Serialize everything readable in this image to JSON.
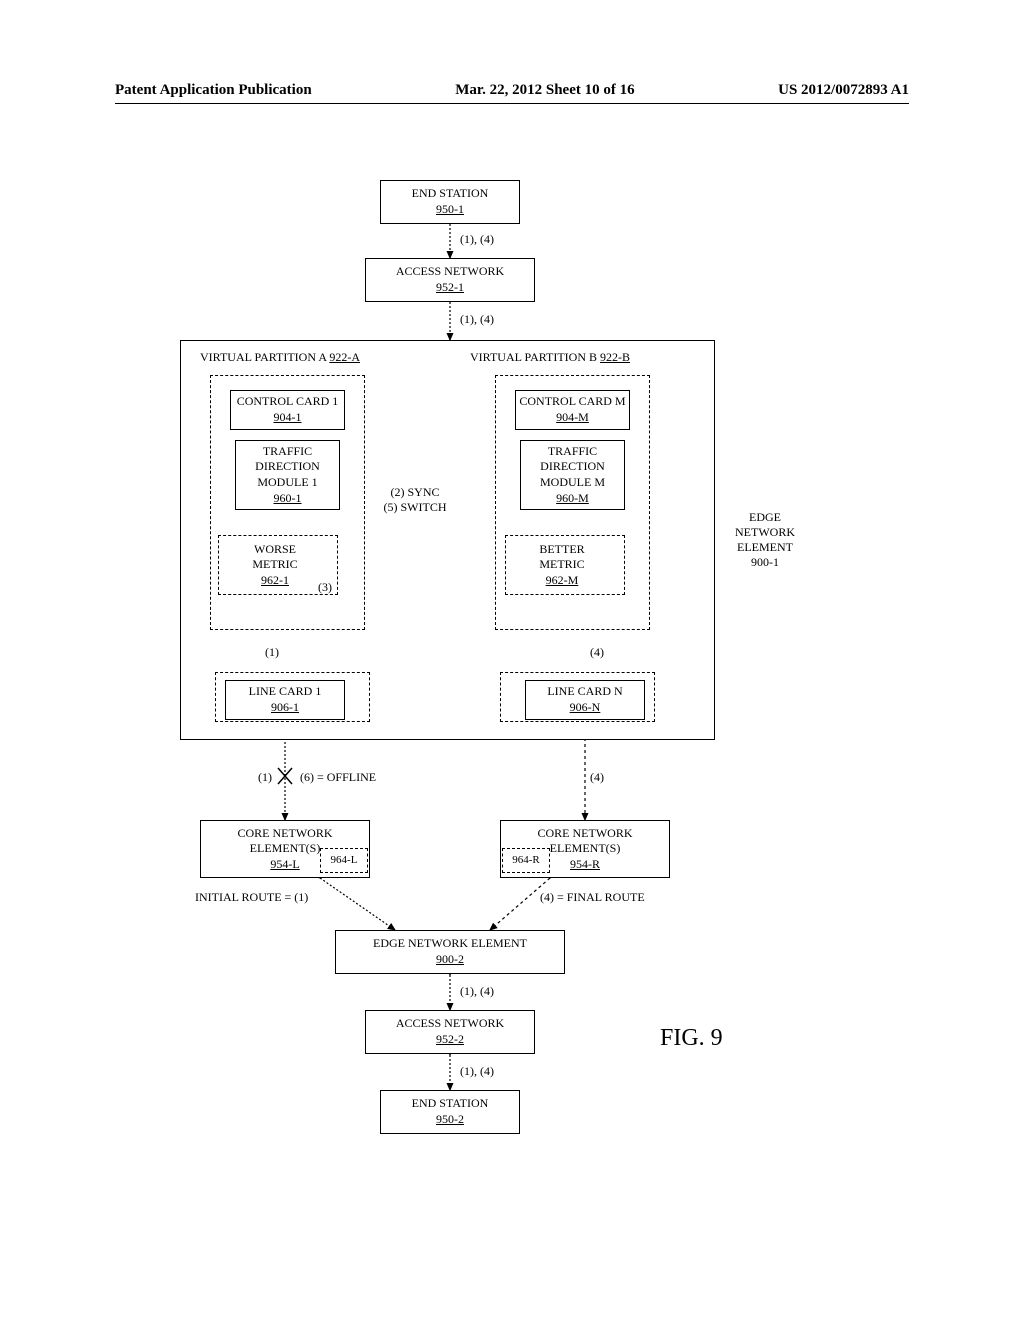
{
  "header": {
    "left": "Patent Application Publication",
    "center": "Mar. 22, 2012  Sheet 10 of 16",
    "right": "US 2012/0072893 A1"
  },
  "figure_label": "FIG. 9",
  "blocks": {
    "end_station_1": {
      "title": "END STATION",
      "ref": "950-1"
    },
    "access_network_1": {
      "title": "ACCESS NETWORK",
      "ref": "952-1"
    },
    "edge_element_label": "EDGE\nNETWORK\nELEMENT\n900-1",
    "partition_a": {
      "label": "VIRTUAL PARTITION A",
      "ref": "922-A"
    },
    "partition_b": {
      "label": "VIRTUAL PARTITION B",
      "ref": "922-B"
    },
    "control_card_1": {
      "title": "CONTROL CARD 1",
      "ref": "904-1"
    },
    "control_card_m": {
      "title": "CONTROL CARD M",
      "ref": "904-M"
    },
    "tdm_1": {
      "title": "TRAFFIC\nDIRECTION\nMODULE 1",
      "ref": "960-1"
    },
    "tdm_m": {
      "title": "TRAFFIC\nDIRECTION\nMODULE M",
      "ref": "960-M"
    },
    "metric_1": {
      "title": "WORSE\nMETRIC",
      "ref": "962-1"
    },
    "metric_m": {
      "title": "BETTER\nMETRIC",
      "ref": "962-M"
    },
    "metric_1_note": "(3)",
    "line_card_1": {
      "title": "LINE CARD 1",
      "ref": "906-1"
    },
    "line_card_n": {
      "title": "LINE CARD N",
      "ref": "906-N"
    },
    "core_l": {
      "title": "CORE NETWORK\nELEMENT(S)",
      "ref": "954-L",
      "sub": "964-L"
    },
    "core_r": {
      "title": "CORE NETWORK\nELEMENT(S)",
      "ref": "954-R",
      "sub": "964-R"
    },
    "edge_element_2": {
      "title": "EDGE NETWORK ELEMENT",
      "ref": "900-2"
    },
    "access_network_2": {
      "title": "ACCESS NETWORK",
      "ref": "952-2"
    },
    "end_station_2": {
      "title": "END STATION",
      "ref": "950-2"
    }
  },
  "annotations": {
    "conn_1_4_a": "(1), (4)",
    "conn_1_4_b": "(1), (4)",
    "sync_switch": "(2) SYNC\n(5) SWITCH",
    "conn_1": "(1)",
    "conn_4": "(4)",
    "offline": "(6) = OFFLINE",
    "initial_route": "INITIAL ROUTE = (1)",
    "final_route": "(4) = FINAL ROUTE",
    "conn_1_4_c": "(1), (4)",
    "conn_1_4_d": "(1), (4)"
  }
}
